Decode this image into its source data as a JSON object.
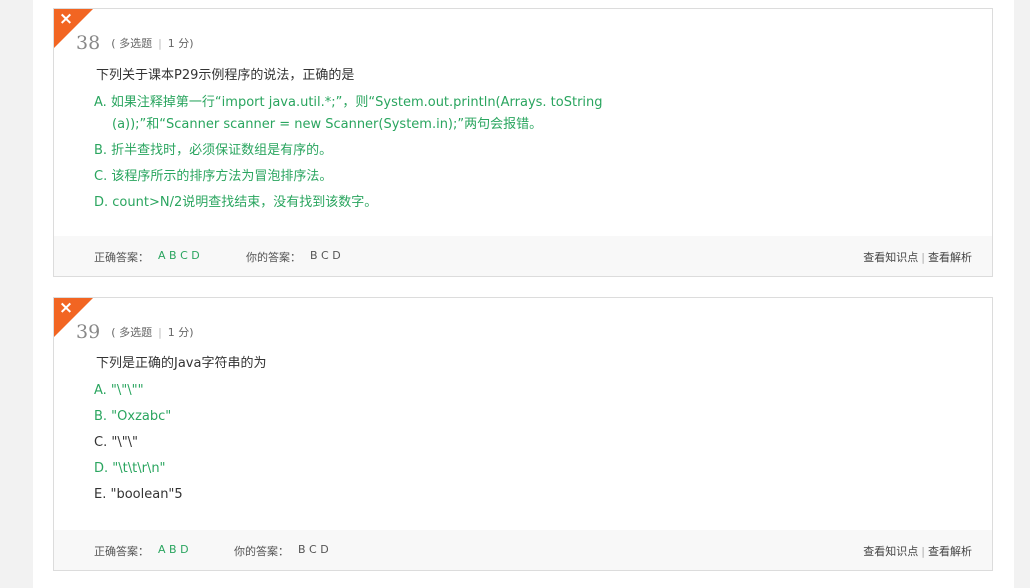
{
  "questions": [
    {
      "number": "38",
      "type": "多选题",
      "score": "1",
      "score_unit": "分",
      "stem": "下列关于课本P29示例程序的说法，正确的是",
      "options": [
        {
          "line1": "A. 如果注释掉第一行“import java.util.*;”，则“System.out.println(Arrays. toString",
          "line2": "(a));”和“Scanner scanner = new Scanner(System.in);”两句会报错。",
          "correct": true
        },
        {
          "line1": "B. 折半查找时，必须保证数组是有序的。",
          "correct": true
        },
        {
          "line1": "C. 该程序所示的排序方法为冒泡排序法。",
          "correct": true
        },
        {
          "line1": "D. count>N/2说明查找结束，没有找到该数字。",
          "correct": true
        }
      ],
      "correct_label": "正确答案：",
      "correct_answer": "A B C D",
      "your_label": "你的答案：",
      "your_answer": "B C D",
      "link_knowledge": "查看知识点",
      "link_analysis": "查看解析"
    },
    {
      "number": "39",
      "type": "多选题",
      "score": "1",
      "score_unit": "分",
      "stem": "下列是正确的Java字符串的为",
      "options": [
        {
          "line1": "A. \"\\\"\\\"\"",
          "correct": true
        },
        {
          "line1": "B. \"Oxzabc\"",
          "correct": true
        },
        {
          "line1": "C. \"\\\"\\\"",
          "correct": false
        },
        {
          "line1": "D. \"\\t\\t\\r\\n\"",
          "correct": true
        },
        {
          "line1": "E. \"boolean\"5",
          "correct": false
        }
      ],
      "correct_label": "正确答案：",
      "correct_answer": "A B D",
      "your_label": "你的答案：",
      "your_answer": "B C D",
      "link_knowledge": "查看知识点",
      "link_analysis": "查看解析"
    }
  ],
  "colors": {
    "correct_green": "#2aa55f",
    "wrong_orange": "#f26522"
  },
  "icons": {
    "wrong_mark": "×"
  }
}
